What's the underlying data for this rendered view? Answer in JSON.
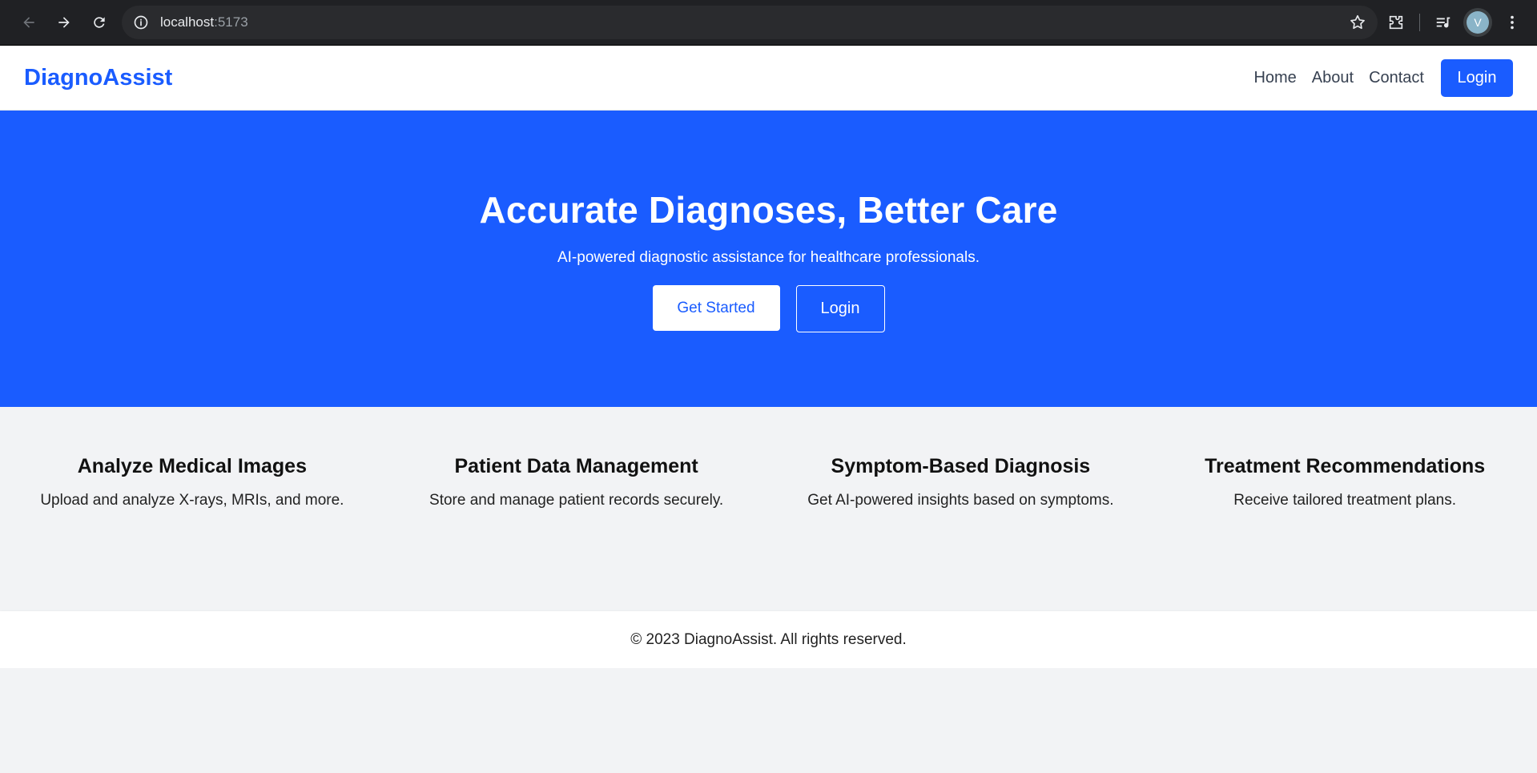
{
  "browser": {
    "url_host": "localhost",
    "url_port": ":5173",
    "avatar_letter": "V"
  },
  "navbar": {
    "brand": "DiagnoAssist",
    "links": [
      "Home",
      "About",
      "Contact"
    ],
    "login_label": "Login"
  },
  "hero": {
    "title": "Accurate Diagnoses, Better Care",
    "subtitle": "AI-powered diagnostic assistance for healthcare professionals.",
    "primary_label": "Get Started",
    "secondary_label": "Login"
  },
  "features": [
    {
      "title": "Analyze Medical Images",
      "text": "Upload and analyze X-rays, MRIs, and more."
    },
    {
      "title": "Patient Data Management",
      "text": "Store and manage patient records securely."
    },
    {
      "title": "Symptom-Based Diagnosis",
      "text": "Get AI-powered insights based on symptoms."
    },
    {
      "title": "Treatment Recommendations",
      "text": "Receive tailored treatment plans."
    }
  ],
  "footer": {
    "text": "© 2023 DiagnoAssist. All rights reserved."
  },
  "colors": {
    "brand": "#1a5cff",
    "section_bg": "#f2f3f5",
    "chrome_bg": "#202124"
  }
}
